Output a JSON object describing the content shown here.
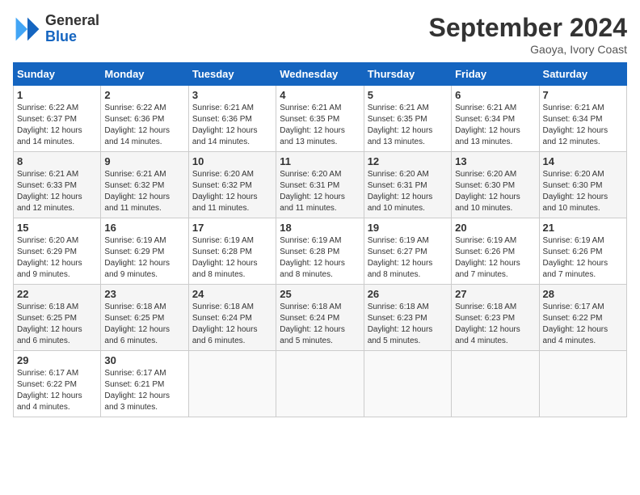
{
  "header": {
    "logo_general": "General",
    "logo_blue": "Blue",
    "month_title": "September 2024",
    "location": "Gaoya, Ivory Coast"
  },
  "weekdays": [
    "Sunday",
    "Monday",
    "Tuesday",
    "Wednesday",
    "Thursday",
    "Friday",
    "Saturday"
  ],
  "weeks": [
    [
      {
        "day": "1",
        "sunrise": "6:22 AM",
        "sunset": "6:37 PM",
        "daylight": "12 hours and 14 minutes."
      },
      {
        "day": "2",
        "sunrise": "6:22 AM",
        "sunset": "6:36 PM",
        "daylight": "12 hours and 14 minutes."
      },
      {
        "day": "3",
        "sunrise": "6:21 AM",
        "sunset": "6:36 PM",
        "daylight": "12 hours and 14 minutes."
      },
      {
        "day": "4",
        "sunrise": "6:21 AM",
        "sunset": "6:35 PM",
        "daylight": "12 hours and 13 minutes."
      },
      {
        "day": "5",
        "sunrise": "6:21 AM",
        "sunset": "6:35 PM",
        "daylight": "12 hours and 13 minutes."
      },
      {
        "day": "6",
        "sunrise": "6:21 AM",
        "sunset": "6:34 PM",
        "daylight": "12 hours and 13 minutes."
      },
      {
        "day": "7",
        "sunrise": "6:21 AM",
        "sunset": "6:34 PM",
        "daylight": "12 hours and 12 minutes."
      }
    ],
    [
      {
        "day": "8",
        "sunrise": "6:21 AM",
        "sunset": "6:33 PM",
        "daylight": "12 hours and 12 minutes."
      },
      {
        "day": "9",
        "sunrise": "6:21 AM",
        "sunset": "6:32 PM",
        "daylight": "12 hours and 11 minutes."
      },
      {
        "day": "10",
        "sunrise": "6:20 AM",
        "sunset": "6:32 PM",
        "daylight": "12 hours and 11 minutes."
      },
      {
        "day": "11",
        "sunrise": "6:20 AM",
        "sunset": "6:31 PM",
        "daylight": "12 hours and 11 minutes."
      },
      {
        "day": "12",
        "sunrise": "6:20 AM",
        "sunset": "6:31 PM",
        "daylight": "12 hours and 10 minutes."
      },
      {
        "day": "13",
        "sunrise": "6:20 AM",
        "sunset": "6:30 PM",
        "daylight": "12 hours and 10 minutes."
      },
      {
        "day": "14",
        "sunrise": "6:20 AM",
        "sunset": "6:30 PM",
        "daylight": "12 hours and 10 minutes."
      }
    ],
    [
      {
        "day": "15",
        "sunrise": "6:20 AM",
        "sunset": "6:29 PM",
        "daylight": "12 hours and 9 minutes."
      },
      {
        "day": "16",
        "sunrise": "6:19 AM",
        "sunset": "6:29 PM",
        "daylight": "12 hours and 9 minutes."
      },
      {
        "day": "17",
        "sunrise": "6:19 AM",
        "sunset": "6:28 PM",
        "daylight": "12 hours and 8 minutes."
      },
      {
        "day": "18",
        "sunrise": "6:19 AM",
        "sunset": "6:28 PM",
        "daylight": "12 hours and 8 minutes."
      },
      {
        "day": "19",
        "sunrise": "6:19 AM",
        "sunset": "6:27 PM",
        "daylight": "12 hours and 8 minutes."
      },
      {
        "day": "20",
        "sunrise": "6:19 AM",
        "sunset": "6:26 PM",
        "daylight": "12 hours and 7 minutes."
      },
      {
        "day": "21",
        "sunrise": "6:19 AM",
        "sunset": "6:26 PM",
        "daylight": "12 hours and 7 minutes."
      }
    ],
    [
      {
        "day": "22",
        "sunrise": "6:18 AM",
        "sunset": "6:25 PM",
        "daylight": "12 hours and 6 minutes."
      },
      {
        "day": "23",
        "sunrise": "6:18 AM",
        "sunset": "6:25 PM",
        "daylight": "12 hours and 6 minutes."
      },
      {
        "day": "24",
        "sunrise": "6:18 AM",
        "sunset": "6:24 PM",
        "daylight": "12 hours and 6 minutes."
      },
      {
        "day": "25",
        "sunrise": "6:18 AM",
        "sunset": "6:24 PM",
        "daylight": "12 hours and 5 minutes."
      },
      {
        "day": "26",
        "sunrise": "6:18 AM",
        "sunset": "6:23 PM",
        "daylight": "12 hours and 5 minutes."
      },
      {
        "day": "27",
        "sunrise": "6:18 AM",
        "sunset": "6:23 PM",
        "daylight": "12 hours and 4 minutes."
      },
      {
        "day": "28",
        "sunrise": "6:17 AM",
        "sunset": "6:22 PM",
        "daylight": "12 hours and 4 minutes."
      }
    ],
    [
      {
        "day": "29",
        "sunrise": "6:17 AM",
        "sunset": "6:22 PM",
        "daylight": "12 hours and 4 minutes."
      },
      {
        "day": "30",
        "sunrise": "6:17 AM",
        "sunset": "6:21 PM",
        "daylight": "12 hours and 3 minutes."
      },
      null,
      null,
      null,
      null,
      null
    ]
  ]
}
